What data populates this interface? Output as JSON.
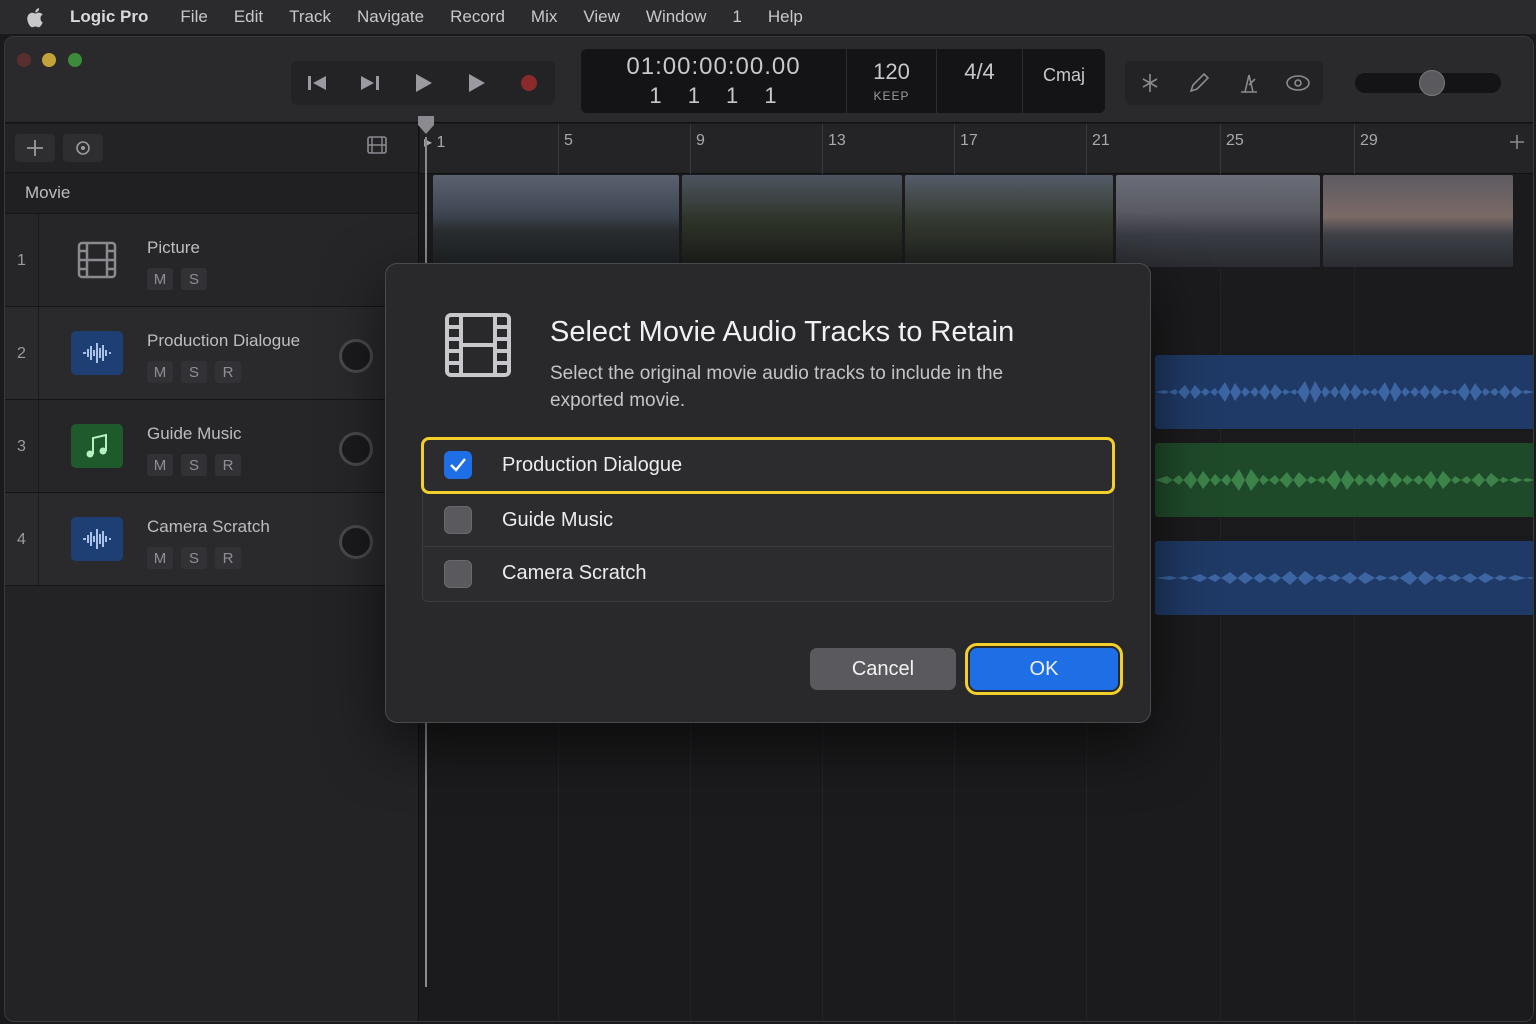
{
  "menubar": {
    "app_name": "Logic Pro",
    "items": [
      "File",
      "Edit",
      "Track",
      "Navigate",
      "Record",
      "Mix",
      "View",
      "Window",
      "1",
      "Help"
    ]
  },
  "lcd": {
    "timecode": "01:00:00:00.00",
    "beats": "1 1 1 1",
    "tempo": "120",
    "tempo_mode": "KEEP",
    "signature": "4/4",
    "key": "Cmaj"
  },
  "tracklist": {
    "section_label": "Movie",
    "tracks": [
      {
        "number": "1",
        "name": "Picture",
        "buttons": [
          "M",
          "S"
        ]
      },
      {
        "number": "2",
        "name": "Production Dialogue",
        "buttons": [
          "M",
          "S",
          "R"
        ]
      },
      {
        "number": "3",
        "name": "Guide Music",
        "buttons": [
          "M",
          "S",
          "R"
        ]
      },
      {
        "number": "4",
        "name": "Camera Scratch",
        "buttons": [
          "M",
          "S",
          "R"
        ]
      }
    ]
  },
  "ruler": {
    "bars": [
      "1",
      "5",
      "9",
      "13",
      "17",
      "21",
      "25",
      "29"
    ]
  },
  "dialog": {
    "title": "Select Movie Audio Tracks to Retain",
    "description": "Select the original movie audio tracks to include in the exported movie.",
    "options": [
      {
        "label": "Production Dialogue",
        "checked": true
      },
      {
        "label": "Guide Music",
        "checked": false
      },
      {
        "label": "Camera Scratch",
        "checked": false
      }
    ],
    "cancel_label": "Cancel",
    "ok_label": "OK"
  },
  "colors": {
    "accent": "#1e6fe6",
    "highlight": "#f2cf2a",
    "audio_region_blue": "#1f3a66",
    "audio_region_green": "#1f4a2a"
  }
}
